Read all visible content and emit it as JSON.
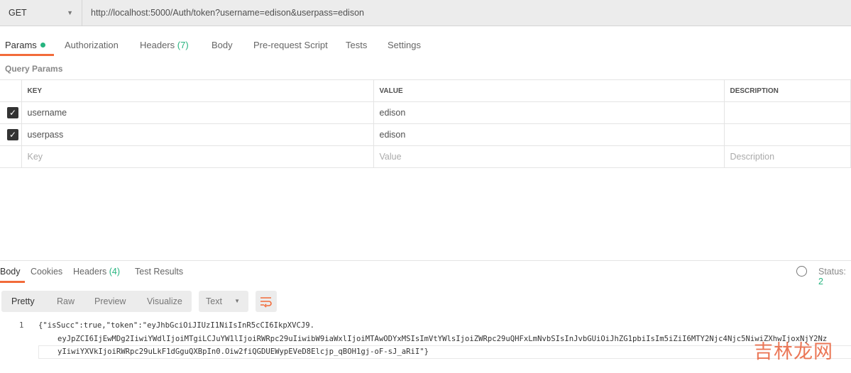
{
  "request": {
    "method": "GET",
    "url": "http://localhost:5000/Auth/token?username=edison&userpass=edison"
  },
  "tabs": [
    {
      "label": "Params"
    },
    {
      "label": "Authorization"
    },
    {
      "label": "Headers",
      "count": "(7)"
    },
    {
      "label": "Body"
    },
    {
      "label": "Pre-request Script"
    },
    {
      "label": "Tests"
    },
    {
      "label": "Settings"
    }
  ],
  "query_params": {
    "title": "Query Params",
    "headers": [
      "KEY",
      "VALUE",
      "DESCRIPTION"
    ],
    "rows": [
      {
        "checked": true,
        "key": "username",
        "value": "edison",
        "description": ""
      },
      {
        "checked": true,
        "key": "userpass",
        "value": "edison",
        "description": ""
      }
    ],
    "placeholders": {
      "key": "Key",
      "value": "Value",
      "description": "Description"
    }
  },
  "response": {
    "tabs": [
      {
        "label": "Body"
      },
      {
        "label": "Cookies"
      },
      {
        "label": "Headers",
        "count": "(4)"
      },
      {
        "label": "Test Results"
      }
    ],
    "status_label": "Status:",
    "status_value": "2",
    "views": [
      "Pretty",
      "Raw",
      "Preview",
      "Visualize"
    ],
    "format": "Text",
    "line_number": "1",
    "lines": [
      "{\"isSucc\":true,\"token\":\"eyJhbGciOiJIUzI1NiIsInR5cCI6IkpXVCJ9.",
      "eyJpZCI6IjEwMDg2IiwiYWdlIjoiMTgiLCJuYW1lIjoiRWRpc29uIiwibW9iaWxlIjoiMTAwODYxMSIsImVtYWlsIjoiZWRpc29uQHFxLmNvbSIsInJvbGUiOiJhZG1pbiIsIm5iZiI6MTY2Njc4Njc5NiwiZXhwIjoxNjY2Nz",
      "yIiwiYXVkIjoiRWRpc29uLkF1dGguQXBpIn0.Oiw2fiQGDUEWypEVeD8Elcjp_qBOH1gj-oF-sJ_aRiI\"}"
    ]
  },
  "watermark": "吉林龙网",
  "colors": {
    "accent": "#f26b3a",
    "success": "#26b47f"
  }
}
